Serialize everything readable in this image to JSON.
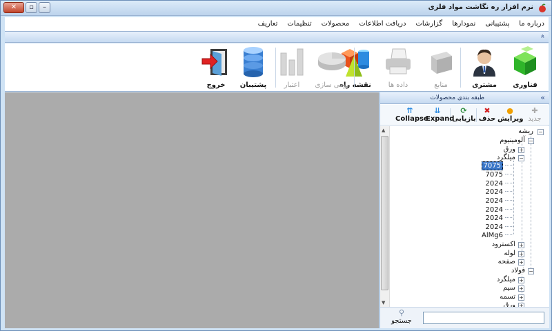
{
  "window": {
    "title": "نرم افزار ره نگاشت مواد فلزی",
    "close_glyph": "✕",
    "maximize_glyph": "▫",
    "minimize_glyph": "–"
  },
  "menu": {
    "items": [
      "تعاریف",
      "تنظیمات",
      "محصولات",
      "دریافت اطلاعات",
      "گزارشات",
      "نمودارها",
      "پشتیبانی",
      "درباره ما"
    ]
  },
  "strip": {
    "chevron_glyph": "«"
  },
  "ribbon": {
    "buttons": [
      {
        "label": "فناوری",
        "icon": "green-cube-icon",
        "enabled": true
      },
      {
        "label": "مشتری",
        "icon": "businessman-icon",
        "enabled": true
      },
      {
        "label": "منابع",
        "icon": "box-icon",
        "enabled": false
      },
      {
        "label": "داده ها",
        "icon": "printer-icon",
        "enabled": false
      },
      {
        "label": "نقشه راه",
        "icon": "shapes-icon",
        "enabled": true
      },
      {
        "label": "بومی سازی",
        "icon": "pie-icon",
        "enabled": false
      },
      {
        "label": "اعتبار",
        "icon": "bar-chart-icon",
        "enabled": false
      },
      {
        "label": "پشتیبان",
        "icon": "database-icon",
        "enabled": true
      },
      {
        "label": "خروج",
        "icon": "exit-door-icon",
        "enabled": true
      }
    ]
  },
  "panel": {
    "title": "طبقه بندی محصولات",
    "chevron_glyph": "«",
    "toolbar": {
      "new": "جدید",
      "edit": "ویرایش",
      "delete": "حذف",
      "refresh": "بازیابی",
      "expand": "Expand",
      "collapse": "Collapse"
    },
    "tree": {
      "root": "ریشه",
      "aluminium": "آلومینیوم",
      "sheet": "ورق",
      "bar": "میلگرد",
      "leaves": [
        "7075",
        "7075",
        "2024",
        "2024",
        "2024",
        "2024",
        "2024",
        "2024",
        "AlMg6"
      ],
      "extrusion": "اکسترود",
      "pipe": "لوله",
      "plate": "صفحه",
      "steel": "فولاد",
      "steel_bar": "میلگرد",
      "wire": "سیم",
      "strip": "تسمه",
      "steel_sheet": "ورق"
    },
    "search": {
      "button": "جستجو",
      "value": ""
    }
  }
}
